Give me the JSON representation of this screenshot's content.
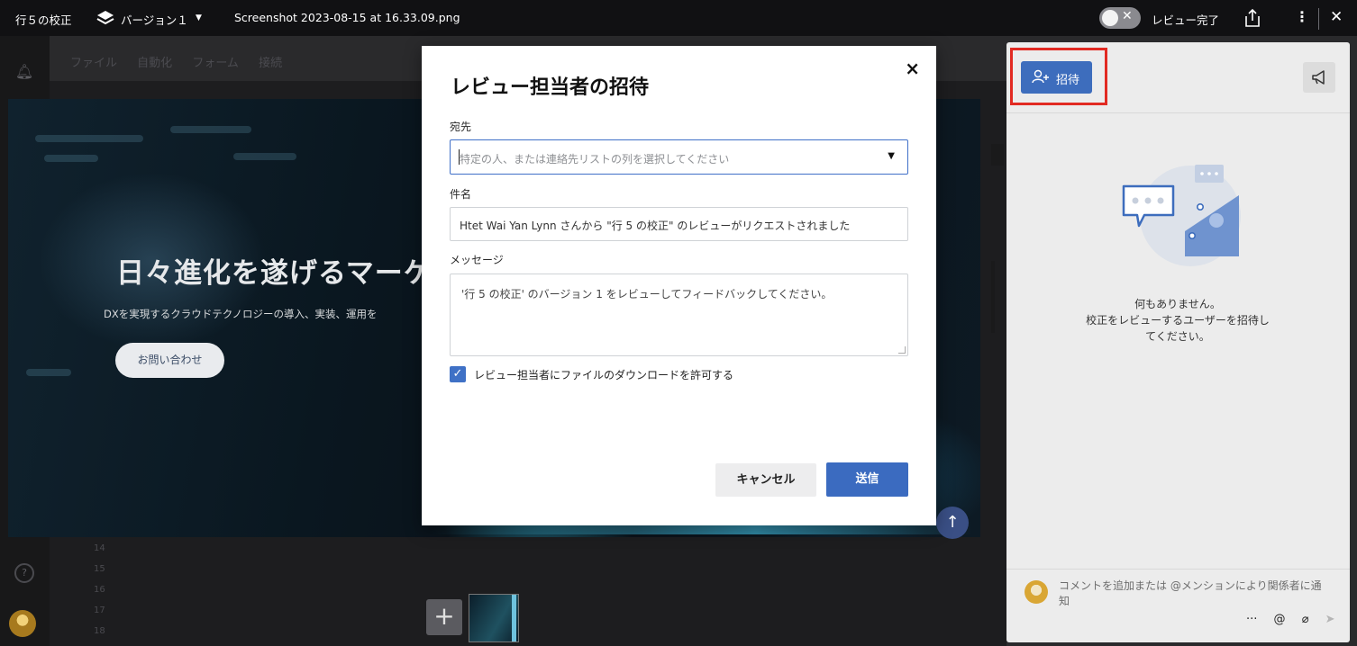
{
  "topbar": {
    "proof_title": "行５の校正",
    "version_label": "バージョン１",
    "version_caret": "▼",
    "file_name": "Screenshot 2023-08-15 at 16.33.09.png",
    "review_complete_label": "レビュー完了",
    "toggle_state": "off",
    "icons": [
      "layers-icon",
      "share-icon",
      "more-vertical-icon",
      "close-icon"
    ]
  },
  "background": {
    "menu": [
      "ファイル",
      "自動化",
      "フォーム",
      "接続"
    ],
    "row_numbers": [
      "14",
      "15",
      "16",
      "17",
      "18"
    ],
    "slide": {
      "title": "日々進化を遂げるマーケテ",
      "subtitle": "DXを実現するクラウドテクノロジーの導入、実装、運用を",
      "button": "お問い合わせ"
    },
    "add_page_symbol": "+",
    "scroll_up_symbol": "↑"
  },
  "modal": {
    "title": "レビュー担当者の招待",
    "close_symbol": "×",
    "to_label": "宛先",
    "to_placeholder": "特定の人、または連絡先リストの列を選択してください",
    "subject_label": "件名",
    "subject_value": "Htet Wai Yan Lynn さんから \"行 5 の校正\" のレビューがリクエストされました",
    "message_label": "メッセージ",
    "message_value": "'行 5 の校正' のバージョン 1 をレビューしてフィードバックしてください。",
    "allow_download_label": "レビュー担当者にファイルのダウンロードを許可する",
    "allow_download_checked": true,
    "cancel_label": "キャンセル",
    "send_label": "送信",
    "accent_color": "#3b6bc0"
  },
  "panel": {
    "invite_label": "招待",
    "empty_line1": "何もありません。",
    "empty_line2": "校正をレビューするユーザーを招待し",
    "empty_line3": "てください。",
    "comment_placeholder": "コメントを追加または @メンションにより関係者に通知",
    "footer_more": "···",
    "footer_mention": "@",
    "footer_attach": "⌀",
    "footer_send": "➤",
    "highlight_color": "#e22a22"
  }
}
